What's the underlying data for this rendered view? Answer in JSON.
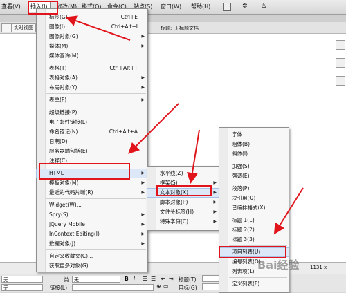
{
  "menubar": {
    "items": [
      "查看(V)",
      "插入(I)",
      "修改(M)",
      "格式(O)",
      "命令(C)",
      "站点(S)",
      "窗口(W)",
      "帮助(H)"
    ]
  },
  "doc_toolbar": {
    "live_view": "实时视图",
    "title_label": "标题:",
    "title_value": "无标题文档"
  },
  "insert_menu": {
    "items": [
      {
        "label": "标签(G)...",
        "shortcut": "Ctrl+E"
      },
      {
        "label": "图像(I)",
        "shortcut": "Ctrl+Alt+I"
      },
      {
        "label": "图像对象(G)"
      },
      {
        "label": "媒体(M)"
      },
      {
        "label": "媒体查询(M)..."
      },
      {
        "label": "表格(T)",
        "shortcut": "Ctrl+Alt+T"
      },
      {
        "label": "表格对象(A)"
      },
      {
        "label": "布局对象(Y)"
      },
      {
        "label": "表单(F)"
      },
      {
        "label": "超级链接(P)"
      },
      {
        "label": "电子邮件链接(L)"
      },
      {
        "label": "命名锚记(N)",
        "shortcut": "Ctrl+Alt+A"
      },
      {
        "label": "日期(D)"
      },
      {
        "label": "服务器端包括(E)"
      },
      {
        "label": "注释(C)"
      },
      {
        "label": "HTML"
      },
      {
        "label": "模板对象(M)"
      },
      {
        "label": "最近的代码片断(R)"
      },
      {
        "label": "Widget(W)..."
      },
      {
        "label": "Spry(S)"
      },
      {
        "label": "jQuery Mobile"
      },
      {
        "label": "InContext Editing(I)"
      },
      {
        "label": "数据对象(J)"
      },
      {
        "label": "自定义收藏夹(C)..."
      },
      {
        "label": "获取更多对象(G)..."
      }
    ]
  },
  "html_submenu": {
    "items": [
      {
        "label": "水平线(Z)"
      },
      {
        "label": "框架(S)"
      },
      {
        "label": "文本对象(X)"
      },
      {
        "label": "脚本对象(P)"
      },
      {
        "label": "文件头标签(H)"
      },
      {
        "label": "特殊字符(C)"
      }
    ]
  },
  "text_submenu": {
    "items": [
      {
        "label": "字体"
      },
      {
        "label": "粗体(B)"
      },
      {
        "label": "斜体(I)"
      },
      {
        "label": "加强(S)"
      },
      {
        "label": "强调(E)"
      },
      {
        "label": "段落(P)"
      },
      {
        "label": "块引用(Q)"
      },
      {
        "label": "已编排格式(X)"
      },
      {
        "label": "标题 1(1)"
      },
      {
        "label": "标题 2(2)"
      },
      {
        "label": "标题 3(3)"
      },
      {
        "label": "项目列表(U)"
      },
      {
        "label": "编号列表(O)"
      },
      {
        "label": "列表项(L)"
      },
      {
        "label": "定义列表(F)"
      }
    ]
  },
  "statusbar": {
    "size": "1131 x"
  },
  "properties": {
    "format_value": "无",
    "class_label": "类",
    "class_value": "无",
    "bold": "B",
    "italic": "I",
    "title_label": "标题(T)",
    "link_label": "链接(L)",
    "target_label": "目标(G)",
    "id_value": "无"
  },
  "watermark": "Bai经验",
  "colors": {
    "annotation_red": "#e1141c",
    "menu_bg": "#f7f7f7",
    "highlight": "#dce8f7"
  }
}
